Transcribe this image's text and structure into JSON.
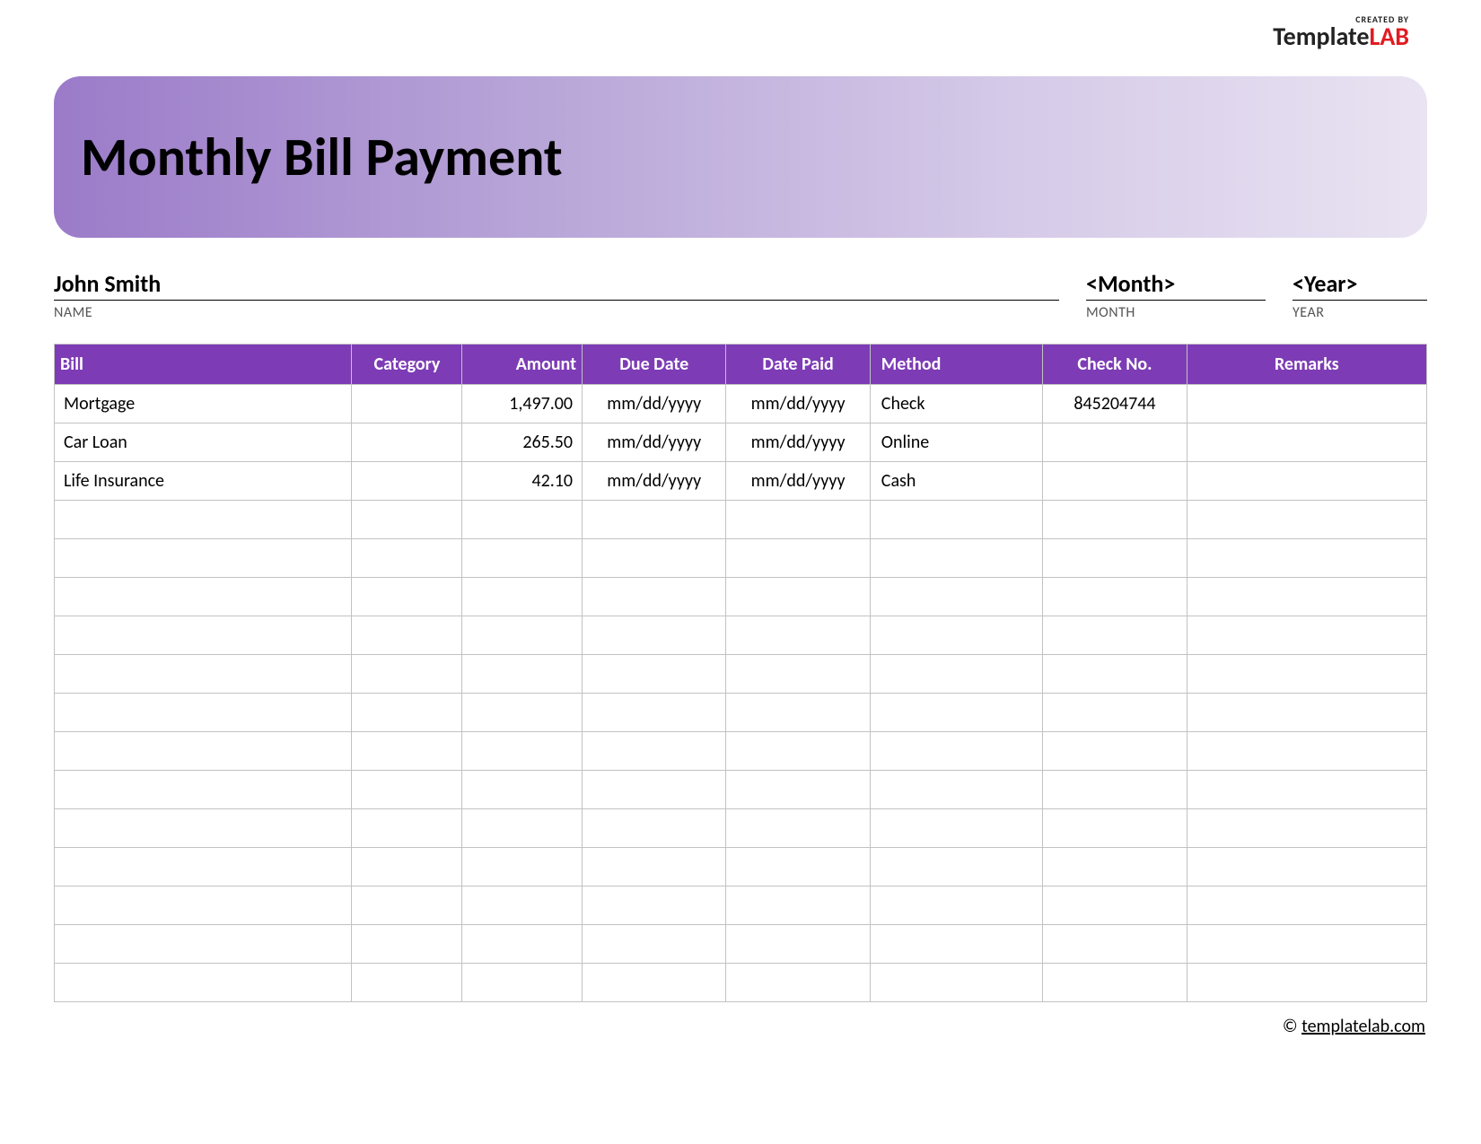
{
  "logo": {
    "created_by": "CREATED BY",
    "name_part1": "Template",
    "name_part2": "LAB"
  },
  "header": {
    "title": "Monthly Bill Payment"
  },
  "info": {
    "name_value": "John Smith",
    "name_label": "NAME",
    "month_value": "<Month>",
    "month_label": "MONTH",
    "year_value": "<Year>",
    "year_label": "YEAR"
  },
  "columns": {
    "bill": "Bill",
    "category": "Category",
    "amount": "Amount",
    "due_date": "Due Date",
    "date_paid": "Date Paid",
    "method": "Method",
    "check_no": "Check No.",
    "remarks": "Remarks"
  },
  "rows": [
    {
      "bill": "Mortgage",
      "category": "",
      "amount": "1,497.00",
      "due_date": "mm/dd/yyyy",
      "date_paid": "mm/dd/yyyy",
      "method": "Check",
      "check_no": "845204744",
      "remarks": ""
    },
    {
      "bill": "Car Loan",
      "category": "",
      "amount": "265.50",
      "due_date": "mm/dd/yyyy",
      "date_paid": "mm/dd/yyyy",
      "method": "Online",
      "check_no": "",
      "remarks": ""
    },
    {
      "bill": "Life Insurance",
      "category": "",
      "amount": "42.10",
      "due_date": "mm/dd/yyyy",
      "date_paid": "mm/dd/yyyy",
      "method": "Cash",
      "check_no": "",
      "remarks": ""
    },
    {
      "bill": "",
      "category": "",
      "amount": "",
      "due_date": "",
      "date_paid": "",
      "method": "",
      "check_no": "",
      "remarks": ""
    },
    {
      "bill": "",
      "category": "",
      "amount": "",
      "due_date": "",
      "date_paid": "",
      "method": "",
      "check_no": "",
      "remarks": ""
    },
    {
      "bill": "",
      "category": "",
      "amount": "",
      "due_date": "",
      "date_paid": "",
      "method": "",
      "check_no": "",
      "remarks": ""
    },
    {
      "bill": "",
      "category": "",
      "amount": "",
      "due_date": "",
      "date_paid": "",
      "method": "",
      "check_no": "",
      "remarks": ""
    },
    {
      "bill": "",
      "category": "",
      "amount": "",
      "due_date": "",
      "date_paid": "",
      "method": "",
      "check_no": "",
      "remarks": ""
    },
    {
      "bill": "",
      "category": "",
      "amount": "",
      "due_date": "",
      "date_paid": "",
      "method": "",
      "check_no": "",
      "remarks": ""
    },
    {
      "bill": "",
      "category": "",
      "amount": "",
      "due_date": "",
      "date_paid": "",
      "method": "",
      "check_no": "",
      "remarks": ""
    },
    {
      "bill": "",
      "category": "",
      "amount": "",
      "due_date": "",
      "date_paid": "",
      "method": "",
      "check_no": "",
      "remarks": ""
    },
    {
      "bill": "",
      "category": "",
      "amount": "",
      "due_date": "",
      "date_paid": "",
      "method": "",
      "check_no": "",
      "remarks": ""
    },
    {
      "bill": "",
      "category": "",
      "amount": "",
      "due_date": "",
      "date_paid": "",
      "method": "",
      "check_no": "",
      "remarks": ""
    },
    {
      "bill": "",
      "category": "",
      "amount": "",
      "due_date": "",
      "date_paid": "",
      "method": "",
      "check_no": "",
      "remarks": ""
    },
    {
      "bill": "",
      "category": "",
      "amount": "",
      "due_date": "",
      "date_paid": "",
      "method": "",
      "check_no": "",
      "remarks": ""
    },
    {
      "bill": "",
      "category": "",
      "amount": "",
      "due_date": "",
      "date_paid": "",
      "method": "",
      "check_no": "",
      "remarks": ""
    }
  ],
  "footer": {
    "copyright": "© ",
    "site": "templatelab.com"
  }
}
